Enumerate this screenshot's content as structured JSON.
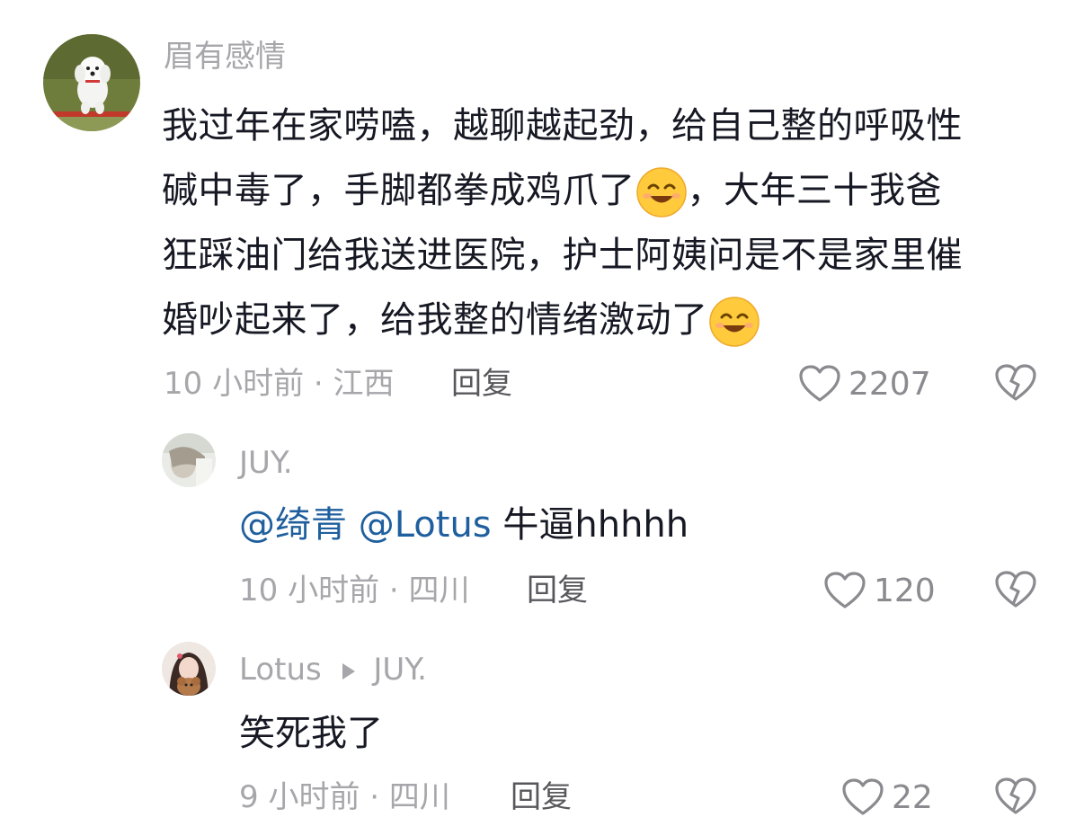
{
  "comments": [
    {
      "username": "眉有感情",
      "lines": [
        "我过年在家唠嗑，越聊越起劲，给自己整的呼吸性",
        "碱中毒了，手脚都拳成鸡爪了",
        "，大年三十我爸",
        "狂踩油门给我送进医院，护士阿姨问是不是家里催",
        "婚吵起来了，给我整的情绪激动了"
      ],
      "time": "10 小时前",
      "location": "江西",
      "reply_label": "回复",
      "like_count": "2207"
    },
    {
      "username": "JUY.",
      "mention1": "@绮青",
      "mention2": "@Lotus",
      "text": "牛逼hhhhh",
      "time": "10 小时前",
      "location": "四川",
      "reply_label": "回复",
      "like_count": "120"
    },
    {
      "username": "Lotus",
      "reply_to": "JUY.",
      "text": "笑死我了",
      "time": "9 小时前",
      "location": "四川",
      "reply_label": "回复",
      "like_count": "22"
    }
  ],
  "meta_separator": "·",
  "icons": {
    "like": "heart-outline-icon",
    "dislike": "broken-heart-icon",
    "emoji": "smiling-face-emoji",
    "reply_arrow": "play-arrow-icon"
  },
  "colors": {
    "text": "#161823",
    "secondary": "#a7a7ab",
    "mention": "#1f5f9e"
  }
}
